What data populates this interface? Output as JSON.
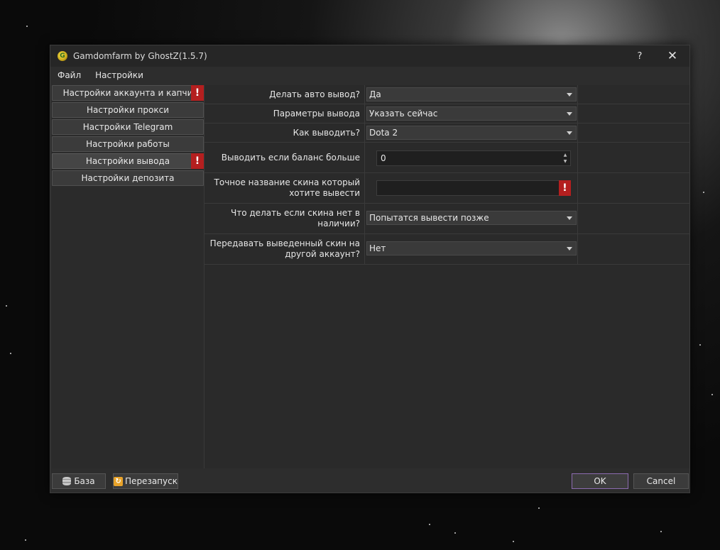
{
  "window": {
    "title": "Gamdomfarm by GhostZ(1.5.7)",
    "help_label": "?",
    "close_label": "✕"
  },
  "menu": {
    "items": [
      "Файл",
      "Настройки"
    ]
  },
  "sidebar": {
    "items": [
      {
        "label": "Настройки аккаунта и капчи",
        "warning": true
      },
      {
        "label": "Настройки прокси",
        "warning": false
      },
      {
        "label": "Настройки Telegram",
        "warning": false
      },
      {
        "label": "Настройки работы",
        "warning": false
      },
      {
        "label": "Настройки вывода",
        "warning": true
      },
      {
        "label": "Настройки депозита",
        "warning": false
      }
    ],
    "warning_mark": "!"
  },
  "settings": {
    "auto_withdraw": {
      "label": "Делать авто вывод?",
      "value": "Да"
    },
    "withdraw_params": {
      "label": "Параметры вывода",
      "value": "Указать сейчас"
    },
    "withdraw_method": {
      "label": "Как выводить?",
      "value": "Dota 2"
    },
    "balance_threshold": {
      "label": "Выводить если баланс больше",
      "value": "0"
    },
    "skin_name": {
      "label": "Точное название скина который хотите вывести",
      "value": ""
    },
    "skin_unavailable": {
      "label": "Что делать если скина нет в наличии?",
      "value": "Попытатся вывести позже"
    },
    "transfer_skin": {
      "label": "Передавать выведенный скин на другой аккаунт?",
      "value": "Нет"
    }
  },
  "footer": {
    "db_label": "База",
    "restart_label": "Перезапуск",
    "ok_label": "OK",
    "cancel_label": "Cancel"
  },
  "colors": {
    "warning": "#b41f1f",
    "ok_border": "#8c6bb0",
    "window_bg": "#2d2d2d"
  },
  "icons": [
    "app-logo-icon",
    "database-icon",
    "restart-icon",
    "dropdown-arrow-icon",
    "spin-up-icon",
    "spin-down-icon",
    "warning-icon"
  ]
}
